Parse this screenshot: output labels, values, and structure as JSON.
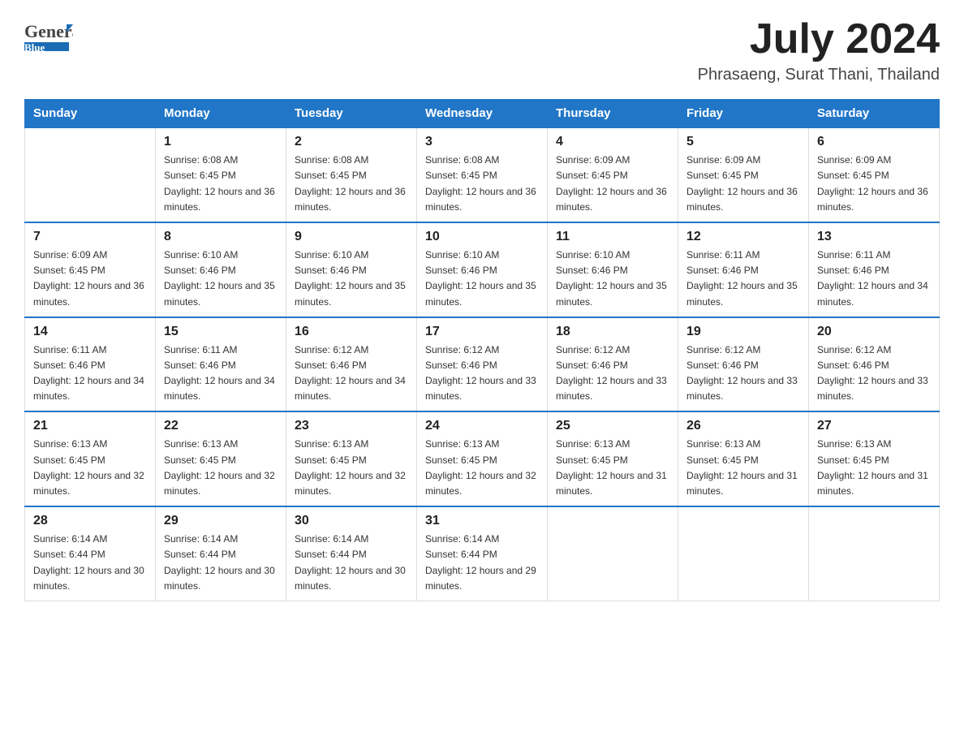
{
  "header": {
    "logo_general": "General",
    "logo_blue": "Blue",
    "month_year": "July 2024",
    "location": "Phrasaeng, Surat Thani, Thailand"
  },
  "days_of_week": [
    "Sunday",
    "Monday",
    "Tuesday",
    "Wednesday",
    "Thursday",
    "Friday",
    "Saturday"
  ],
  "weeks": [
    [
      {
        "day": "",
        "sunrise": "",
        "sunset": "",
        "daylight": ""
      },
      {
        "day": "1",
        "sunrise": "Sunrise: 6:08 AM",
        "sunset": "Sunset: 6:45 PM",
        "daylight": "Daylight: 12 hours and 36 minutes."
      },
      {
        "day": "2",
        "sunrise": "Sunrise: 6:08 AM",
        "sunset": "Sunset: 6:45 PM",
        "daylight": "Daylight: 12 hours and 36 minutes."
      },
      {
        "day": "3",
        "sunrise": "Sunrise: 6:08 AM",
        "sunset": "Sunset: 6:45 PM",
        "daylight": "Daylight: 12 hours and 36 minutes."
      },
      {
        "day": "4",
        "sunrise": "Sunrise: 6:09 AM",
        "sunset": "Sunset: 6:45 PM",
        "daylight": "Daylight: 12 hours and 36 minutes."
      },
      {
        "day": "5",
        "sunrise": "Sunrise: 6:09 AM",
        "sunset": "Sunset: 6:45 PM",
        "daylight": "Daylight: 12 hours and 36 minutes."
      },
      {
        "day": "6",
        "sunrise": "Sunrise: 6:09 AM",
        "sunset": "Sunset: 6:45 PM",
        "daylight": "Daylight: 12 hours and 36 minutes."
      }
    ],
    [
      {
        "day": "7",
        "sunrise": "Sunrise: 6:09 AM",
        "sunset": "Sunset: 6:45 PM",
        "daylight": "Daylight: 12 hours and 36 minutes."
      },
      {
        "day": "8",
        "sunrise": "Sunrise: 6:10 AM",
        "sunset": "Sunset: 6:46 PM",
        "daylight": "Daylight: 12 hours and 35 minutes."
      },
      {
        "day": "9",
        "sunrise": "Sunrise: 6:10 AM",
        "sunset": "Sunset: 6:46 PM",
        "daylight": "Daylight: 12 hours and 35 minutes."
      },
      {
        "day": "10",
        "sunrise": "Sunrise: 6:10 AM",
        "sunset": "Sunset: 6:46 PM",
        "daylight": "Daylight: 12 hours and 35 minutes."
      },
      {
        "day": "11",
        "sunrise": "Sunrise: 6:10 AM",
        "sunset": "Sunset: 6:46 PM",
        "daylight": "Daylight: 12 hours and 35 minutes."
      },
      {
        "day": "12",
        "sunrise": "Sunrise: 6:11 AM",
        "sunset": "Sunset: 6:46 PM",
        "daylight": "Daylight: 12 hours and 35 minutes."
      },
      {
        "day": "13",
        "sunrise": "Sunrise: 6:11 AM",
        "sunset": "Sunset: 6:46 PM",
        "daylight": "Daylight: 12 hours and 34 minutes."
      }
    ],
    [
      {
        "day": "14",
        "sunrise": "Sunrise: 6:11 AM",
        "sunset": "Sunset: 6:46 PM",
        "daylight": "Daylight: 12 hours and 34 minutes."
      },
      {
        "day": "15",
        "sunrise": "Sunrise: 6:11 AM",
        "sunset": "Sunset: 6:46 PM",
        "daylight": "Daylight: 12 hours and 34 minutes."
      },
      {
        "day": "16",
        "sunrise": "Sunrise: 6:12 AM",
        "sunset": "Sunset: 6:46 PM",
        "daylight": "Daylight: 12 hours and 34 minutes."
      },
      {
        "day": "17",
        "sunrise": "Sunrise: 6:12 AM",
        "sunset": "Sunset: 6:46 PM",
        "daylight": "Daylight: 12 hours and 33 minutes."
      },
      {
        "day": "18",
        "sunrise": "Sunrise: 6:12 AM",
        "sunset": "Sunset: 6:46 PM",
        "daylight": "Daylight: 12 hours and 33 minutes."
      },
      {
        "day": "19",
        "sunrise": "Sunrise: 6:12 AM",
        "sunset": "Sunset: 6:46 PM",
        "daylight": "Daylight: 12 hours and 33 minutes."
      },
      {
        "day": "20",
        "sunrise": "Sunrise: 6:12 AM",
        "sunset": "Sunset: 6:46 PM",
        "daylight": "Daylight: 12 hours and 33 minutes."
      }
    ],
    [
      {
        "day": "21",
        "sunrise": "Sunrise: 6:13 AM",
        "sunset": "Sunset: 6:45 PM",
        "daylight": "Daylight: 12 hours and 32 minutes."
      },
      {
        "day": "22",
        "sunrise": "Sunrise: 6:13 AM",
        "sunset": "Sunset: 6:45 PM",
        "daylight": "Daylight: 12 hours and 32 minutes."
      },
      {
        "day": "23",
        "sunrise": "Sunrise: 6:13 AM",
        "sunset": "Sunset: 6:45 PM",
        "daylight": "Daylight: 12 hours and 32 minutes."
      },
      {
        "day": "24",
        "sunrise": "Sunrise: 6:13 AM",
        "sunset": "Sunset: 6:45 PM",
        "daylight": "Daylight: 12 hours and 32 minutes."
      },
      {
        "day": "25",
        "sunrise": "Sunrise: 6:13 AM",
        "sunset": "Sunset: 6:45 PM",
        "daylight": "Daylight: 12 hours and 31 minutes."
      },
      {
        "day": "26",
        "sunrise": "Sunrise: 6:13 AM",
        "sunset": "Sunset: 6:45 PM",
        "daylight": "Daylight: 12 hours and 31 minutes."
      },
      {
        "day": "27",
        "sunrise": "Sunrise: 6:13 AM",
        "sunset": "Sunset: 6:45 PM",
        "daylight": "Daylight: 12 hours and 31 minutes."
      }
    ],
    [
      {
        "day": "28",
        "sunrise": "Sunrise: 6:14 AM",
        "sunset": "Sunset: 6:44 PM",
        "daylight": "Daylight: 12 hours and 30 minutes."
      },
      {
        "day": "29",
        "sunrise": "Sunrise: 6:14 AM",
        "sunset": "Sunset: 6:44 PM",
        "daylight": "Daylight: 12 hours and 30 minutes."
      },
      {
        "day": "30",
        "sunrise": "Sunrise: 6:14 AM",
        "sunset": "Sunset: 6:44 PM",
        "daylight": "Daylight: 12 hours and 30 minutes."
      },
      {
        "day": "31",
        "sunrise": "Sunrise: 6:14 AM",
        "sunset": "Sunset: 6:44 PM",
        "daylight": "Daylight: 12 hours and 29 minutes."
      },
      {
        "day": "",
        "sunrise": "",
        "sunset": "",
        "daylight": ""
      },
      {
        "day": "",
        "sunrise": "",
        "sunset": "",
        "daylight": ""
      },
      {
        "day": "",
        "sunrise": "",
        "sunset": "",
        "daylight": ""
      }
    ]
  ]
}
